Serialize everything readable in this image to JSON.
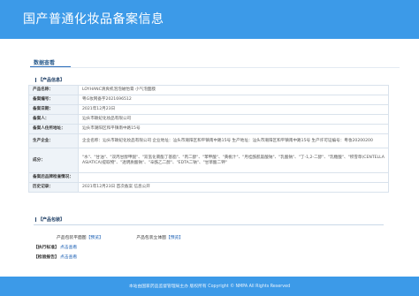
{
  "header": {
    "title": "国产普通化妆品备案信息"
  },
  "tab": {
    "label": "数据查看"
  },
  "sections": {
    "product": "【产品信息】",
    "package": "【产品包装】",
    "standard": "【执行标准】",
    "report": "【检验报告】"
  },
  "info_rows": [
    {
      "key": "产品名称：",
      "value": "LOYHANC清爽机泡泡磁怡膏 小气泡面膜"
    },
    {
      "key": "备案编号：",
      "value": "粤G妆网备字2021696512"
    },
    {
      "key": "备案日期：",
      "value": "2021年12月23日"
    },
    {
      "key": "备案人：",
      "value": "汕头市颖妃化妆品有限公司"
    },
    {
      "key": "备案人住所地址：",
      "value": "汕头市潮阳区和平镇南中路15号"
    },
    {
      "key": "生产企业：",
      "value": "企业名称：汕头市颖妃化妆品有限公司 企业地址：汕头市潮阳区和平镇南中路15号 生产地址：汕头市潮阳区和平镇南中路15号 生产许可证编号：粤妆20200200"
    },
    {
      "key": "成分：",
      "value": "\"水\"、\"甘油\"、\"双丙甘醇甲醚\"、\"双氢化菊酯丁基脂\"、\"丙二醇\"、\"苯甲酸\"、\"黄桃汁\"、\"月桂酰肌氨酸钠\"、\"乳酸钠\"、\"丁-1,2-二醇\"、\"乳糖酸\"、\"积雪草(CENTELLA ASIATICA)提取物\"、\"透明质酸钠\"、\"辛酰乙二醇\"、\"EDTA二钠\"、\"甘草酸二钾\""
    },
    {
      "key": "备案后品牌检查情况：",
      "value": ""
    },
    {
      "key": "历史记录：",
      "value": "2021年12月23日 首次备案 信息公开"
    }
  ],
  "package": {
    "front_label": "产品包装平面图",
    "front_link": "【预览】",
    "stereo_label": "产品包装立体图",
    "stereo_link": "【预览】"
  },
  "standard": {
    "link": "点击查看"
  },
  "report": {
    "link": "点击查看"
  },
  "footer": {
    "text": "本站由国家药品监督管理局主办 版权所有 Copyright © NMPA All Rights Reserved"
  }
}
